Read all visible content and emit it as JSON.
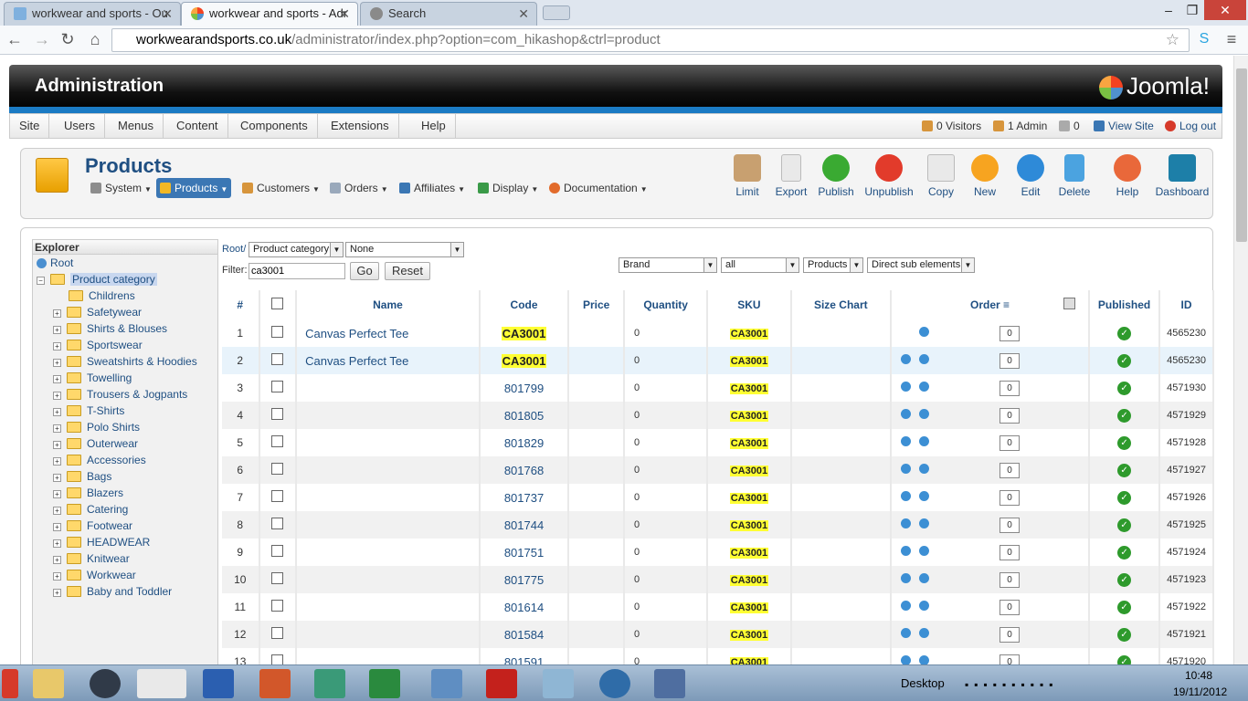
{
  "browser": {
    "tabs": [
      {
        "title": "workwear and sports - Ou"
      },
      {
        "title": "workwear and sports - Adr"
      },
      {
        "title": "Search"
      }
    ],
    "url_host": "workwearandsports.co.uk",
    "url_path": "/administrator/index.php?option=com_hikashop&ctrl=product"
  },
  "admin": {
    "header_title": "Administration",
    "logo_text": "Joomla!",
    "menu": [
      "Site",
      "Users",
      "Menus",
      "Content",
      "Components",
      "Extensions",
      "Help"
    ],
    "status": {
      "visitors": "0 Visitors",
      "admins": "1 Admin",
      "messages": "0",
      "view_site": "View Site",
      "logout": "Log out"
    }
  },
  "products": {
    "title": "Products",
    "submenu": [
      "System",
      "Products",
      "Customers",
      "Orders",
      "Affiliates",
      "Display",
      "Documentation"
    ],
    "toolbar": [
      "Limit",
      "Export",
      "Publish",
      "Unpublish",
      "Copy",
      "New",
      "Edit",
      "Delete",
      "Help",
      "Dashboard"
    ]
  },
  "explorer": {
    "title": "Explorer",
    "root": "Root",
    "category": "Product category",
    "items": [
      "Childrens",
      "Safetywear",
      "Shirts & Blouses",
      "Sportswear",
      "Sweatshirts & Hoodies",
      "Towelling",
      "Trousers & Jogpants",
      "T-Shirts",
      "Polo Shirts",
      "Outerwear",
      "Accessories",
      "Bags",
      "Blazers",
      "Catering",
      "Footwear",
      "HEADWEAR",
      "Knitwear",
      "Workwear",
      "Baby and Toddler"
    ]
  },
  "filters": {
    "root_label": "Root/",
    "category_select": "Product category",
    "none_select": "None",
    "filter_label": "Filter:",
    "filter_value": "ca3001",
    "go": "Go",
    "reset": "Reset",
    "brand_select": "Brand",
    "all_select": "all",
    "products_select": "Products",
    "direct_select": "Direct sub elements"
  },
  "table": {
    "headers": [
      "#",
      "Name",
      "Code",
      "Price",
      "Quantity",
      "SKU",
      "Size Chart",
      "Order",
      "Published",
      "ID"
    ],
    "rows": [
      {
        "num": "1",
        "name": "Canvas Perfect Tee",
        "code": "CA3001",
        "qty": "0",
        "sku": "CA3001",
        "order": "0",
        "id": "4565230"
      },
      {
        "num": "2",
        "name": "Canvas Perfect Tee",
        "code": "CA3001",
        "qty": "0",
        "sku": "CA3001",
        "order": "0",
        "id": "4565230"
      },
      {
        "num": "3",
        "name": "",
        "code": "801799",
        "qty": "0",
        "sku": "CA3001",
        "order": "0",
        "id": "4571930"
      },
      {
        "num": "4",
        "name": "",
        "code": "801805",
        "qty": "0",
        "sku": "CA3001",
        "order": "0",
        "id": "4571929"
      },
      {
        "num": "5",
        "name": "",
        "code": "801829",
        "qty": "0",
        "sku": "CA3001",
        "order": "0",
        "id": "4571928"
      },
      {
        "num": "6",
        "name": "",
        "code": "801768",
        "qty": "0",
        "sku": "CA3001",
        "order": "0",
        "id": "4571927"
      },
      {
        "num": "7",
        "name": "",
        "code": "801737",
        "qty": "0",
        "sku": "CA3001",
        "order": "0",
        "id": "4571926"
      },
      {
        "num": "8",
        "name": "",
        "code": "801744",
        "qty": "0",
        "sku": "CA3001",
        "order": "0",
        "id": "4571925"
      },
      {
        "num": "9",
        "name": "",
        "code": "801751",
        "qty": "0",
        "sku": "CA3001",
        "order": "0",
        "id": "4571924"
      },
      {
        "num": "10",
        "name": "",
        "code": "801775",
        "qty": "0",
        "sku": "CA3001",
        "order": "0",
        "id": "4571923"
      },
      {
        "num": "11",
        "name": "",
        "code": "801614",
        "qty": "0",
        "sku": "CA3001",
        "order": "0",
        "id": "4571922"
      },
      {
        "num": "12",
        "name": "",
        "code": "801584",
        "qty": "0",
        "sku": "CA3001",
        "order": "0",
        "id": "4571921"
      },
      {
        "num": "13",
        "name": "",
        "code": "801591",
        "qty": "0",
        "sku": "CA3001",
        "order": "0",
        "id": "4571920"
      }
    ]
  },
  "taskbar": {
    "desktop": "Desktop",
    "time": "10:48",
    "date": "19/11/2012"
  }
}
